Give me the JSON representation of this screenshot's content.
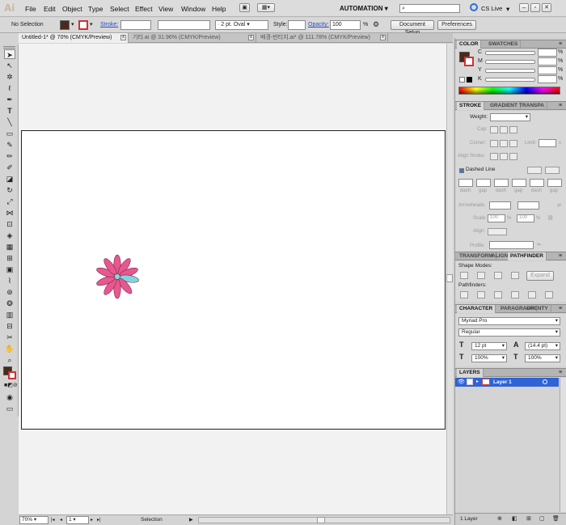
{
  "app": {
    "logo": "Ai",
    "workspace": "AUTOMATION",
    "cslive": "CS Live"
  },
  "menu": [
    "File",
    "Edit",
    "Object",
    "Type",
    "Select",
    "Effect",
    "View",
    "Window",
    "Help"
  ],
  "control": {
    "selection": "No Selection",
    "stroke_label": "Stroke:",
    "brush": "2 pt. Oval",
    "style_label": "Style:",
    "opacity_label": "Opacity:",
    "opacity_value": "100",
    "opacity_unit": "%",
    "doc_setup": "Document Setup",
    "preferences": "Preferences",
    "fill_color": "#4a2a1c"
  },
  "tabs": [
    {
      "label": "Untitled-1* @ 70% (CMYK/Preview)"
    },
    {
      "label": "기타.ai @ 31.96% (CMYK/Preview)"
    },
    {
      "label": "배경-반티지.ai* @ 111.78% (CMYK/Preview)"
    }
  ],
  "status": {
    "zoom": "70%",
    "page": "1",
    "mode": "Selection"
  },
  "color_panel": {
    "tabs": [
      "COLOR",
      "SWATCHES"
    ],
    "channels": [
      "C",
      "M",
      "Y",
      "K"
    ],
    "unit": "%"
  },
  "stroke_panel": {
    "tabs": [
      "STROKE",
      "GRADIENT",
      "TRANSPA"
    ],
    "weight_label": "Weight:",
    "cap_label": "Cap:",
    "corner_label": "Corner:",
    "limit_label": "Limit:",
    "limit_unit": "x",
    "align_label": "Align Stroke:",
    "dashed_label": "Dashed Line",
    "dash_labels": [
      "dash",
      "gap",
      "dash",
      "gap",
      "dash",
      "gap"
    ],
    "arrowheads_label": "Arrowheads:",
    "scale_label": "Scale:",
    "scale1": "100",
    "scale2": "100",
    "scale_unit": "%",
    "align2_label": "Align:",
    "profile_label": "Profile:"
  },
  "pathfinder_panel": {
    "tabs": [
      "TRANSFORM",
      "ALIGN",
      "PATHFINDER"
    ],
    "shape_modes": "Shape Modes:",
    "expand": "Expand",
    "pathfinders": "Pathfinders:"
  },
  "character_panel": {
    "tabs": [
      "CHARACTER",
      "PARAGRAPH",
      "OPENTY"
    ],
    "font": "Myriad Pro",
    "style": "Regular",
    "size": "12 pt",
    "leading": "(14.4 pt)",
    "hscale": "100%",
    "vscale": "100%"
  },
  "layers_panel": {
    "tab": "LAYERS",
    "layer_name": "Layer 1",
    "count": "1 Layer",
    "layer_color": "#2f63d6"
  },
  "flower": {
    "petal_color": "#e8578f",
    "accent_petal": "#7fd6e0",
    "center_color": "#8fd4d8"
  }
}
